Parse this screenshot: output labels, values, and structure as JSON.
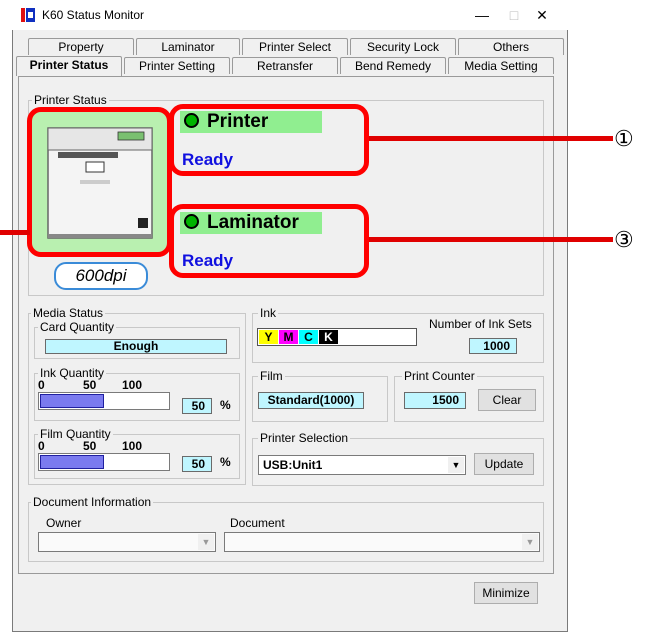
{
  "window": {
    "title": "K60 Status Monitor",
    "min_glyph": "—",
    "max_glyph": "□",
    "close_glyph": "✕"
  },
  "tabs_row1": [
    "Property",
    "Laminator",
    "Printer Select",
    "Security Lock",
    "Others"
  ],
  "tabs_row2": [
    "Printer Status",
    "Printer Setting",
    "Retransfer",
    "Bend Remedy",
    "Media Setting"
  ],
  "printer_status": {
    "group_label": "Printer Status",
    "printer_label": "Printer",
    "printer_state": "Ready",
    "laminator_label": "Laminator",
    "laminator_state": "Ready",
    "dpi": "600dpi"
  },
  "media_status": {
    "group_label": "Media Status",
    "card_quantity_label": "Card Quantity",
    "card_quantity_value": "Enough",
    "ink_quantity_label": "Ink Quantity",
    "ink_scale": [
      "0",
      "50",
      "100"
    ],
    "ink_value": "50",
    "ink_level": 0.5,
    "film_quantity_label": "Film Quantity",
    "film_scale": [
      "0",
      "50",
      "100"
    ],
    "film_value": "50",
    "film_level": 0.5,
    "percent": "%"
  },
  "ink": {
    "group_label": "Ink",
    "colors": [
      "Y",
      "M",
      "C",
      "K"
    ],
    "ink_sets_label": "Number of Ink Sets",
    "ink_sets_value": "1000"
  },
  "film": {
    "group_label": "Film",
    "value": "Standard(1000)"
  },
  "print_counter": {
    "group_label": "Print Counter",
    "value": "1500",
    "clear_label": "Clear"
  },
  "printer_selection": {
    "group_label": "Printer Selection",
    "selected": "USB:Unit1",
    "update_label": "Update"
  },
  "document_info": {
    "group_label": "Document Information",
    "owner_label": "Owner",
    "document_label": "Document"
  },
  "minimize_label": "Minimize",
  "callouts": {
    "one": "①",
    "three": "③"
  },
  "colors": {
    "red_frame": "#ff0000",
    "status_green": "#90ee90",
    "ready_blue": "#1010e0",
    "cyan_field": "#bff6ff",
    "bar_fill": "#7b7bef"
  }
}
